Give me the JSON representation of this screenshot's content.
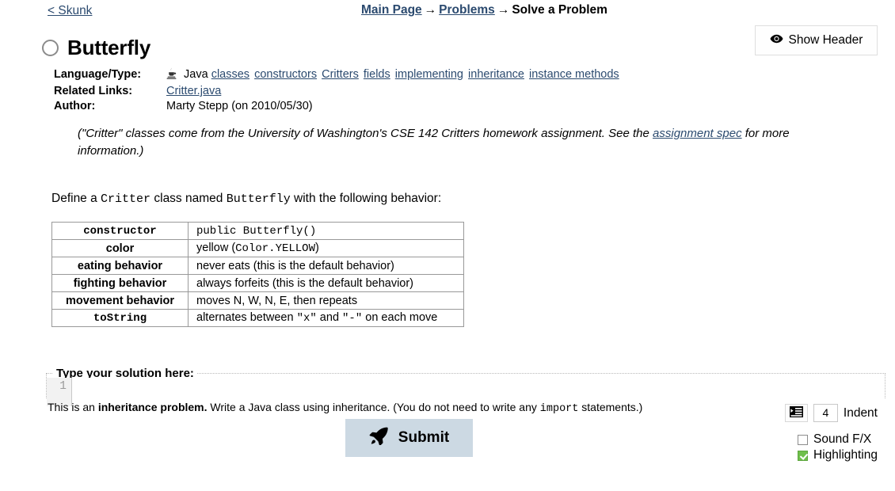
{
  "nav": {
    "back_link": "< Skunk",
    "breadcrumb": [
      {
        "label": "Main Page",
        "link": true
      },
      {
        "label": "Problems",
        "link": true
      },
      {
        "label": "Solve a Problem",
        "link": false
      }
    ],
    "separator": "→",
    "show_header_label": "Show Header",
    "show_header_icon": "eye-icon"
  },
  "problem": {
    "status_icon": "unsolved-circle-icon",
    "title": "Butterfly",
    "meta": {
      "language_label": "Language/Type:",
      "language_icon": "java-icon",
      "language_value": "Java",
      "tags": [
        "classes",
        "constructors",
        "Critters",
        "fields",
        "implementing",
        "inheritance",
        "instance methods"
      ],
      "related_label": "Related Links:",
      "related_links": [
        "Critter.java"
      ],
      "author_label": "Author:",
      "author_value": "Marty Stepp (on 2010/05/30)"
    },
    "note": {
      "text_before": "(\"Critter\" classes come from the University of Washington's CSE 142 Critters homework assignment. See the ",
      "link": "assignment spec",
      "text_after": " for more information.)"
    },
    "prompt": {
      "part1": "Define a ",
      "code1": "Critter",
      "part2": " class named ",
      "code2": "Butterfly",
      "part3": " with the following behavior:"
    },
    "behavior_table": [
      {
        "key": "constructor",
        "key_mono": true,
        "value": "public Butterfly()",
        "value_mono": true
      },
      {
        "key": "color",
        "key_mono": false,
        "value_segments": [
          {
            "text": "yellow (",
            "mono": false
          },
          {
            "text": "Color.YELLOW",
            "mono": true
          },
          {
            "text": ")",
            "mono": false
          }
        ]
      },
      {
        "key": "eating behavior",
        "key_mono": false,
        "value": "never eats (this is the default behavior)",
        "value_mono": false
      },
      {
        "key": "fighting behavior",
        "key_mono": false,
        "value": "always forfeits (this is the default behavior)",
        "value_mono": false
      },
      {
        "key": "movement behavior",
        "key_mono": false,
        "value": "moves N, W, N, E, then repeats",
        "value_mono": false
      },
      {
        "key": "toString",
        "key_mono": true,
        "value_segments": [
          {
            "text": "alternates between ",
            "mono": false
          },
          {
            "text": "\"x\"",
            "mono": true
          },
          {
            "text": " and ",
            "mono": false
          },
          {
            "text": "\"-\"",
            "mono": true
          },
          {
            "text": " on each move",
            "mono": false
          }
        ]
      }
    ]
  },
  "editor": {
    "legend": "Type your solution here:",
    "line_number": "1",
    "code_value": ""
  },
  "footer": {
    "hint_part1": "This is an ",
    "hint_bold": "inheritance problem.",
    "hint_part2": " Write a Java class using inheritance. (You do not need to write any ",
    "hint_code": "import",
    "hint_part3": " statements.)",
    "submit_label": "Submit",
    "submit_icon": "rocket-icon",
    "indent_icon": "indent-icon",
    "indent_value": "4",
    "indent_label": "Indent",
    "checkboxes": [
      {
        "label": "Sound F/X",
        "checked": false
      },
      {
        "label": "Highlighting",
        "checked": true
      }
    ]
  },
  "colors": {
    "link": "#2b4a6f",
    "submit_bg": "#ccd9e3",
    "checked_green": "#6fbf4b"
  }
}
